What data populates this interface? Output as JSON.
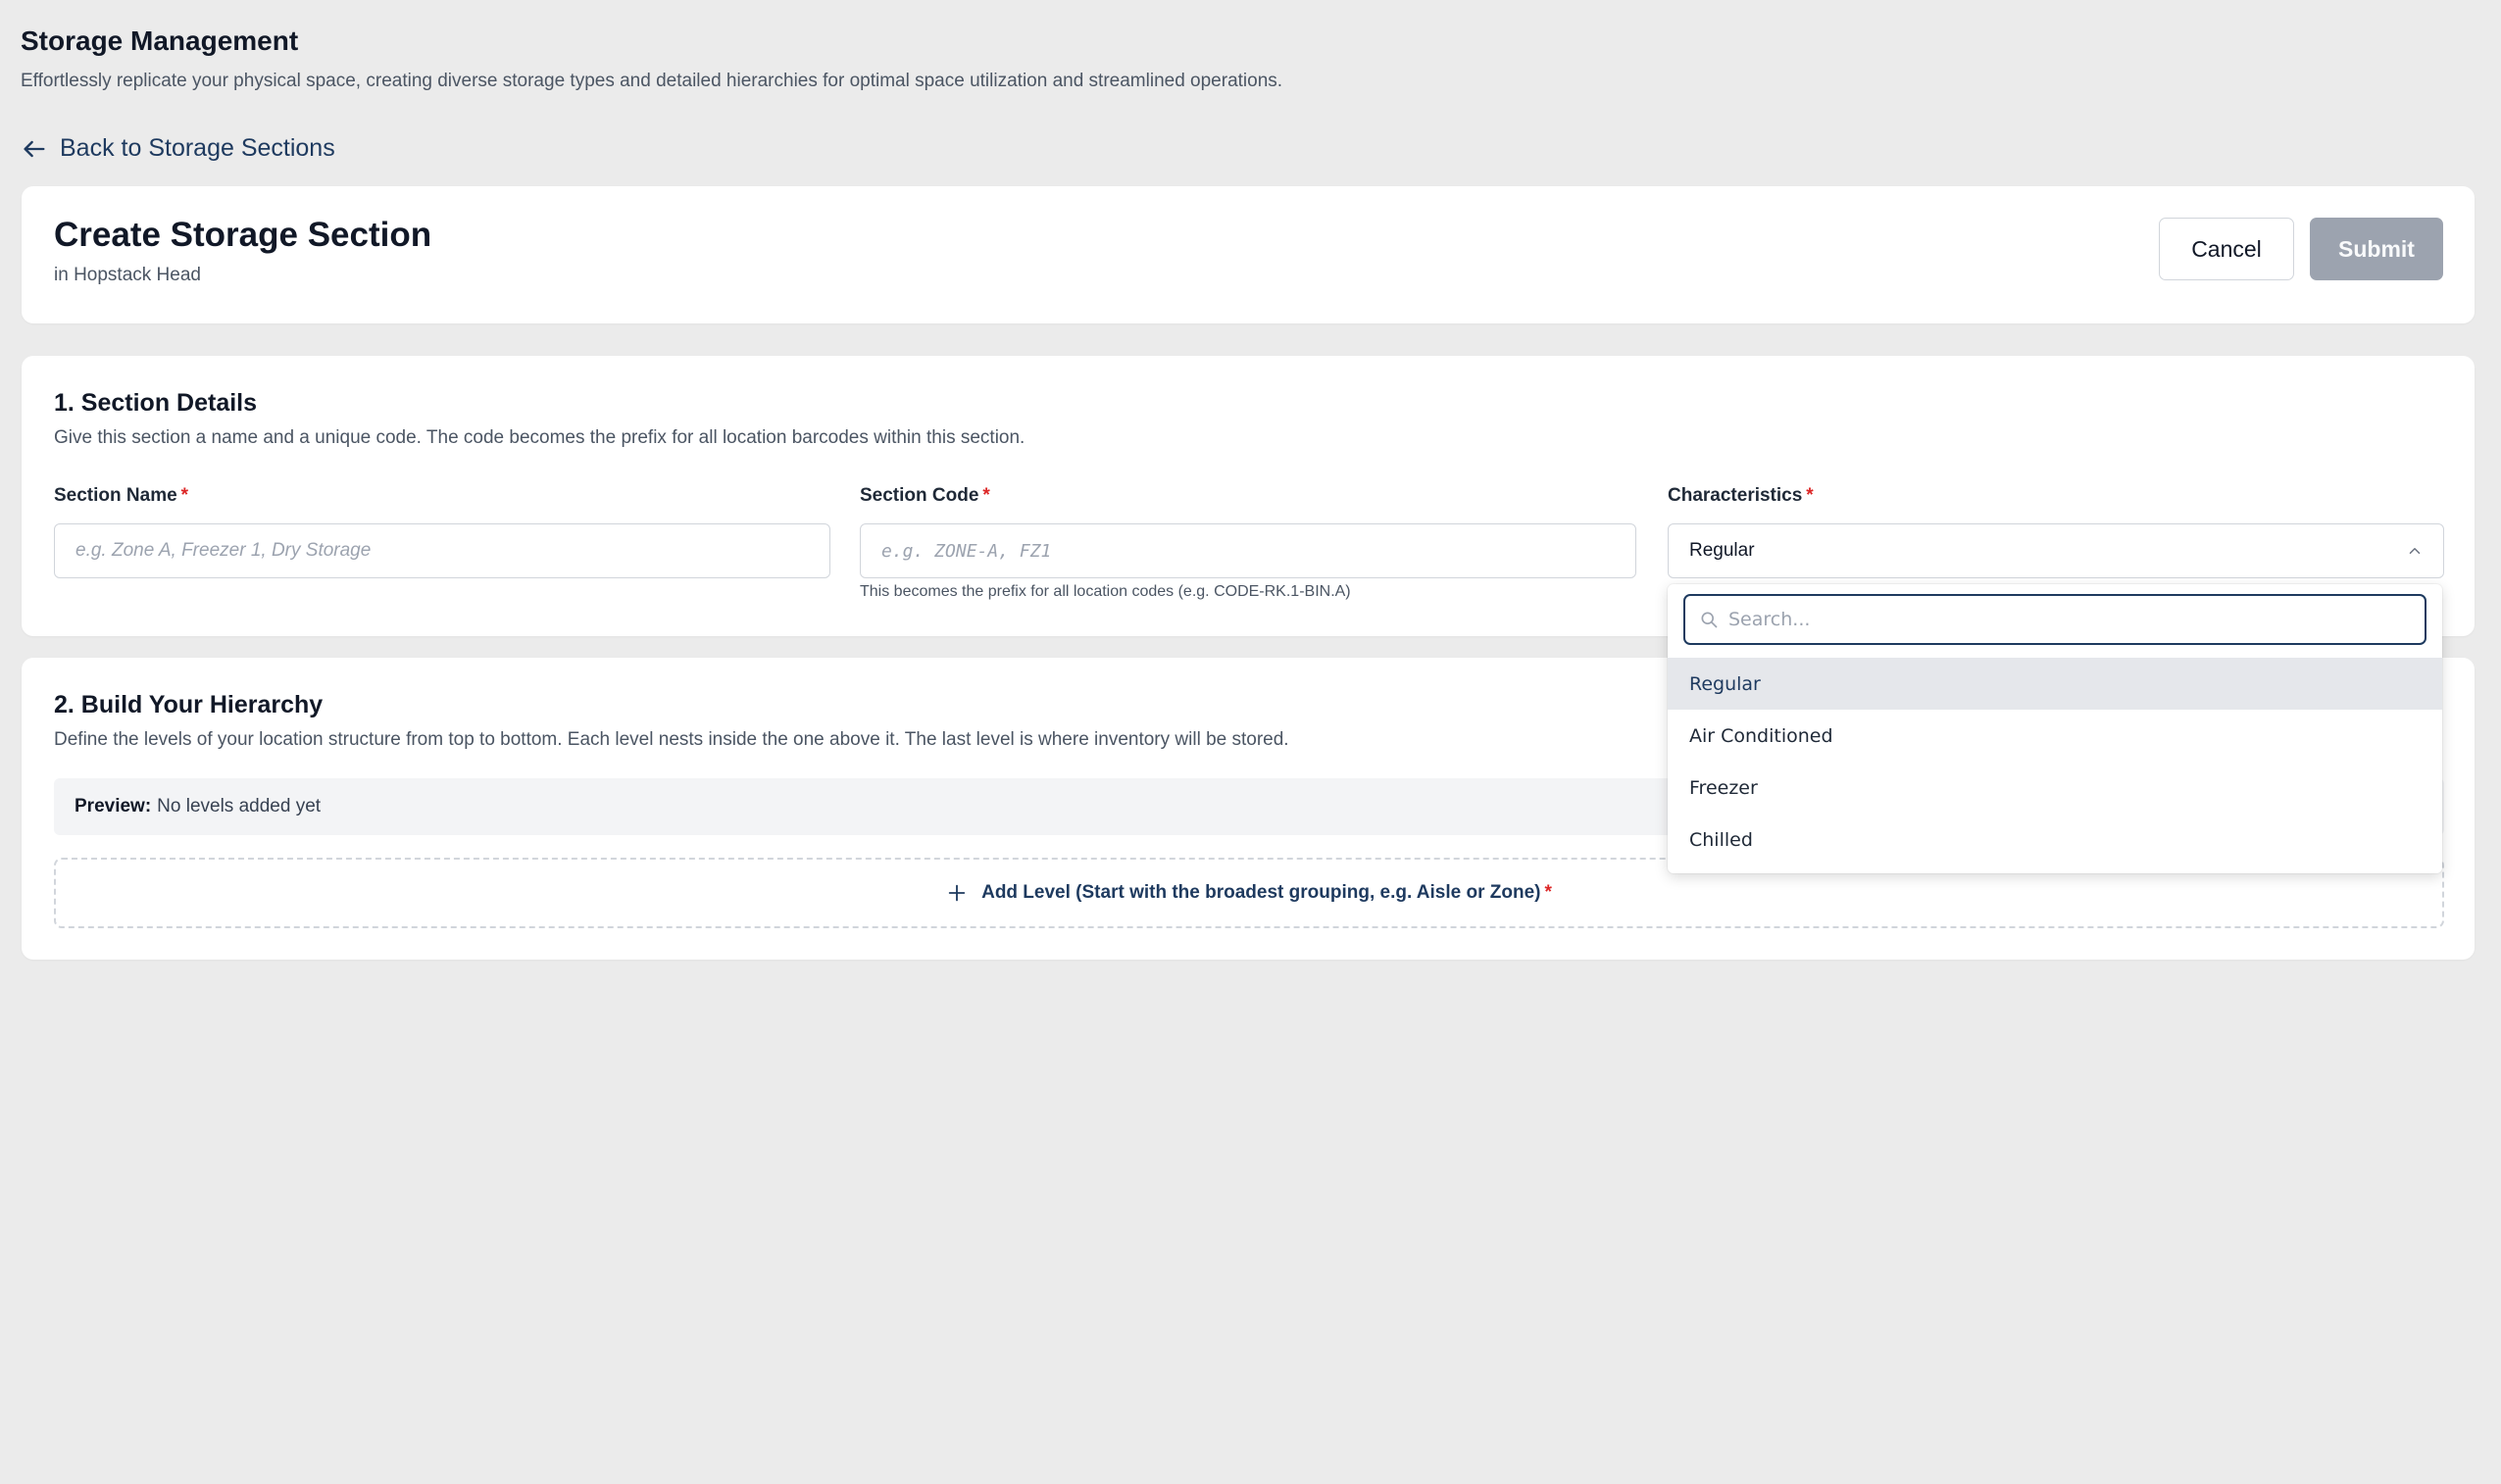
{
  "page": {
    "title": "Storage Management",
    "subtitle": "Effortlessly replicate your physical space, creating diverse storage types and detailed hierarchies for optimal space utilization and streamlined operations."
  },
  "back_link": {
    "label": "Back to Storage Sections",
    "icon": "arrow-left-icon"
  },
  "form_header": {
    "title": "Create Storage Section",
    "subtitle": "in Hopstack Head",
    "cancel_label": "Cancel",
    "submit_label": "Submit"
  },
  "section_details": {
    "title": "1. Section Details",
    "description": "Give this section a name and a unique code. The code becomes the prefix for all location barcodes within this section.",
    "required_marker": "*",
    "section_name": {
      "label": "Section Name",
      "placeholder": "e.g. Zone A, Freezer 1, Dry Storage",
      "value": ""
    },
    "section_code": {
      "label": "Section Code",
      "placeholder": "e.g. ZONE-A, FZ1",
      "value": "",
      "help": "This becomes the prefix for all location codes (e.g. CODE-RK.1-BIN.A)"
    },
    "characteristics": {
      "label": "Characteristics",
      "value": "Regular"
    }
  },
  "hierarchy": {
    "title": "2. Build Your Hierarchy",
    "description": "Define the levels of your location structure from top to bottom. Each level nests inside the one above it. The last level is where inventory will be stored.",
    "preview_label": "Preview:",
    "preview_value": "No levels added yet",
    "add_level_label": "Add Level (Start with the broadest grouping, e.g. Aisle or Zone)",
    "required_marker": "*"
  },
  "dropdown": {
    "search_placeholder": "Search...",
    "selected": "Regular",
    "options": [
      "Regular",
      "Air Conditioned",
      "Freezer",
      "Chilled"
    ]
  },
  "colors": {
    "background": "#ebebeb",
    "card": "#ffffff",
    "accent": "#1e3a5f",
    "required": "#dc2626",
    "submit_disabled": "#9ca3af"
  }
}
